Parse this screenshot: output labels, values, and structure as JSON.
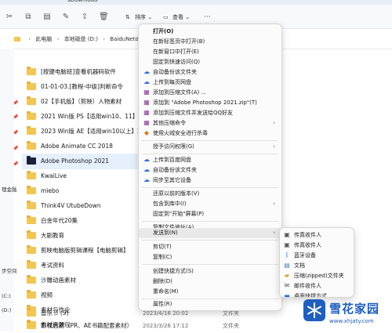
{
  "window": {
    "title_fragment": "sDownload"
  },
  "toolbar": {
    "sort_label": "排序",
    "view_label": "查看",
    "more_label": "···"
  },
  "address": {
    "crumbs": [
      "此电脑",
      "本地磁盘 (D:)",
      "BaiduNetdiskD"
    ]
  },
  "nav": {
    "items": [
      "理金融",
      "步空间",
      "(C:)",
      "(D:)"
    ]
  },
  "files": [
    {
      "name": "[按键电脑班]查看机器码软件",
      "date": "",
      "type": ""
    },
    {
      "name": "01-01-03.[教程-中级]判断命令",
      "date": "",
      "type": ""
    },
    {
      "name": "02【手机版】（剪映）人物素材",
      "date": "",
      "type": ""
    },
    {
      "name": "2021 Win版 PS【适用win10、11】",
      "date": "",
      "type": ""
    },
    {
      "name": "2023 Win版 AE【适用win10以上】23.0",
      "date": "",
      "type": ""
    },
    {
      "name": "Adobe Animate CC 2018",
      "date": "",
      "type": ""
    },
    {
      "name": "Adobe Photoshop 2021",
      "date": "",
      "type": ""
    },
    {
      "name": "KwaiLive",
      "date": "",
      "type": ""
    },
    {
      "name": "miebo",
      "date": "",
      "type": ""
    },
    {
      "name": "Think4V UtubeDown",
      "date": "",
      "type": ""
    },
    {
      "name": "白金年代20集",
      "date": "",
      "type": ""
    },
    {
      "name": "大剧教育",
      "date": "",
      "type": ""
    },
    {
      "name": "剪映电脑版剪辑课程【电脑剪辑】",
      "date": "",
      "type": ""
    },
    {
      "name": "考试资料",
      "date": "",
      "type": ""
    },
    {
      "name": "沙雕动画素材",
      "date": "",
      "type": ""
    },
    {
      "name": "视频",
      "date": "",
      "type": ""
    },
    {
      "name": "素材与作业",
      "date": "",
      "type": ""
    },
    {
      "name": "素材资源包",
      "date": "",
      "type": ""
    },
    {
      "name": "音乐节 (9)",
      "date": "2023/4/16 20:02",
      "type": "文件夹"
    },
    {
      "name": "影视后期（PR、AE书籍配套素材）",
      "date": "2023/3/26 17:12",
      "type": "文件夹"
    }
  ],
  "context_menu": {
    "items": [
      {
        "label": "打开(O)",
        "bold": true,
        "icon": ""
      },
      {
        "label": "在新标签页中打开(B)",
        "icon": ""
      },
      {
        "label": "在新窗口中打开(E)",
        "icon": ""
      },
      {
        "label": "固定到快速访问(Q)",
        "icon": ""
      },
      {
        "label": "自动备份该文件夹",
        "icon": "baidu-cloud-icon"
      },
      {
        "label": "上传到每页网盘",
        "icon": "baidu-cloud-icon"
      },
      {
        "label": "添加到压缩文件(A) ...",
        "icon": "archive-icon"
      },
      {
        "label": "添加到 \"Adobe Photoshop 2021.zip\"(T)",
        "icon": "archive-icon"
      },
      {
        "label": "添加到压缩文件并发送给QQ好友",
        "icon": "archive-icon"
      },
      {
        "label": "其他压缩命令",
        "icon": "archive-icon",
        "arrow": true
      },
      {
        "label": "使用火绒安全进行杀毒",
        "icon": "shield-icon"
      },
      {
        "label": "授予访问权限(G)",
        "icon": "",
        "arrow": true
      },
      {
        "label": "上传到百度网盘",
        "icon": "baidu-cloud-icon"
      },
      {
        "label": "自动备份该文件夹",
        "icon": "baidu-cloud-icon"
      },
      {
        "label": "同步至其它设备",
        "icon": "baidu-cloud-icon"
      },
      {
        "label": "还原以前的版本(V)",
        "icon": ""
      },
      {
        "label": "包含到库中(I)",
        "icon": "",
        "arrow": true
      },
      {
        "label": "固定到\"开始\"屏幕(P)",
        "icon": ""
      },
      {
        "label": "复制文件地址(A)",
        "icon": ""
      },
      {
        "label": "发送到(N)",
        "icon": "",
        "arrow": true,
        "hover": true
      },
      {
        "label": "剪切(T)",
        "icon": ""
      },
      {
        "label": "复制(C)",
        "icon": ""
      },
      {
        "label": "创建快捷方式(S)",
        "icon": ""
      },
      {
        "label": "删除(D)",
        "icon": ""
      },
      {
        "label": "重命名(M)",
        "icon": ""
      },
      {
        "label": "属性(R)",
        "icon": ""
      }
    ]
  },
  "send_to": {
    "items": [
      {
        "label": "传真收件人",
        "icon": "fax-icon"
      },
      {
        "label": "传真收件人",
        "icon": "fax-icon"
      },
      {
        "label": "蓝牙设备",
        "icon": "bluetooth-icon"
      },
      {
        "label": "文档",
        "icon": "document-icon"
      },
      {
        "label": "压缩(zipped)文件夹",
        "icon": "zip-folder-icon"
      },
      {
        "label": "邮件收件人",
        "icon": "mail-icon"
      },
      {
        "label": "桌面快捷方式",
        "icon": "desktop-icon"
      }
    ]
  },
  "watermark": {
    "title": "雪花家园",
    "url": "www.xhjaty.com"
  },
  "colors": {
    "folder": "#f3c64e",
    "accent": "#1f5fbf",
    "selection": "#e5f0fc"
  }
}
